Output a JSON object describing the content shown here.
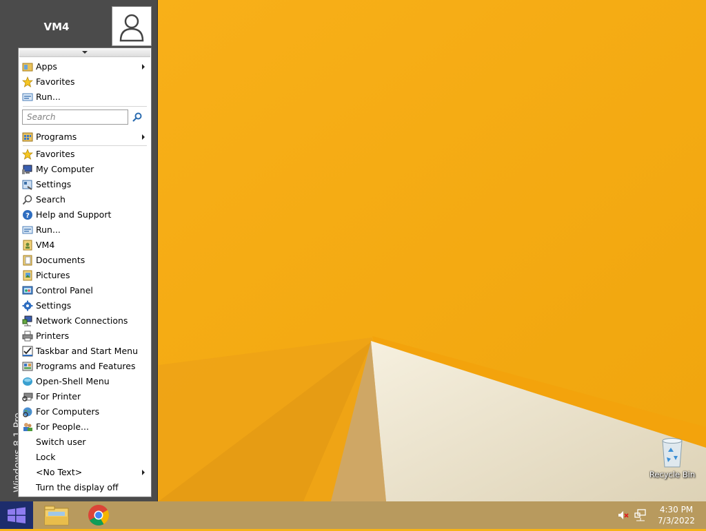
{
  "start_menu": {
    "user_name": "VM4",
    "os_band": "Windows 8.1 Pro",
    "search_placeholder": "Search",
    "top_items": [
      {
        "label": "Apps",
        "icon": "apps-folder-icon",
        "has_submenu": true
      },
      {
        "label": "Favorites",
        "icon": "star-icon",
        "has_submenu": false
      },
      {
        "label": "Run...",
        "icon": "run-icon",
        "has_submenu": false
      }
    ],
    "items": [
      {
        "label": "Programs",
        "icon": "programs-icon",
        "has_submenu": true
      },
      {
        "label": "Favorites",
        "icon": "star-icon",
        "has_submenu": false
      },
      {
        "label": "My Computer",
        "icon": "computer-icon",
        "has_submenu": false
      },
      {
        "label": "Settings",
        "icon": "settings-panel-icon",
        "has_submenu": false
      },
      {
        "label": "Search",
        "icon": "magnifier-icon",
        "has_submenu": false
      },
      {
        "label": "Help and Support",
        "icon": "help-icon",
        "has_submenu": false
      },
      {
        "label": "Run...",
        "icon": "run-icon",
        "has_submenu": false
      },
      {
        "label": "VM4",
        "icon": "user-folder-icon",
        "has_submenu": false
      },
      {
        "label": "Documents",
        "icon": "documents-icon",
        "has_submenu": false
      },
      {
        "label": "Pictures",
        "icon": "pictures-icon",
        "has_submenu": false
      },
      {
        "label": "Control Panel",
        "icon": "control-panel-icon",
        "has_submenu": false
      },
      {
        "label": "Settings",
        "icon": "gear-icon",
        "has_submenu": false
      },
      {
        "label": "Network Connections",
        "icon": "network-icon",
        "has_submenu": false
      },
      {
        "label": "Printers",
        "icon": "printer-icon",
        "has_submenu": false
      },
      {
        "label": "Taskbar and Start Menu",
        "icon": "taskbar-icon",
        "has_submenu": false
      },
      {
        "label": "Programs and Features",
        "icon": "programs-features-icon",
        "has_submenu": false
      },
      {
        "label": "Open-Shell Menu",
        "icon": "shell-icon",
        "has_submenu": false
      },
      {
        "label": "For Printer",
        "icon": "find-printer-icon",
        "has_submenu": false
      },
      {
        "label": "For Computers",
        "icon": "find-computer-icon",
        "has_submenu": false
      },
      {
        "label": "For People...",
        "icon": "find-people-icon",
        "has_submenu": false
      },
      {
        "label": "Switch user",
        "icon": "",
        "has_submenu": false
      },
      {
        "label": "Lock",
        "icon": "",
        "has_submenu": false
      },
      {
        "label": "<No Text>",
        "icon": "",
        "has_submenu": true
      },
      {
        "label": "Turn the display off",
        "icon": "",
        "has_submenu": false
      }
    ]
  },
  "desktop": {
    "recycle_bin_label": "Recycle Bin"
  },
  "taskbar": {
    "apps": [
      {
        "name": "file-explorer",
        "icon": "folder-icon"
      },
      {
        "name": "chrome",
        "icon": "chrome-icon"
      }
    ],
    "clock_time": "4:30 PM",
    "clock_date": "7/3/2022"
  },
  "colors": {
    "wallpaper": "#f6b318",
    "menu_frame": "#4b4b4b",
    "taskbar": "#b89a5e",
    "start_button": "#1d2d6c"
  }
}
